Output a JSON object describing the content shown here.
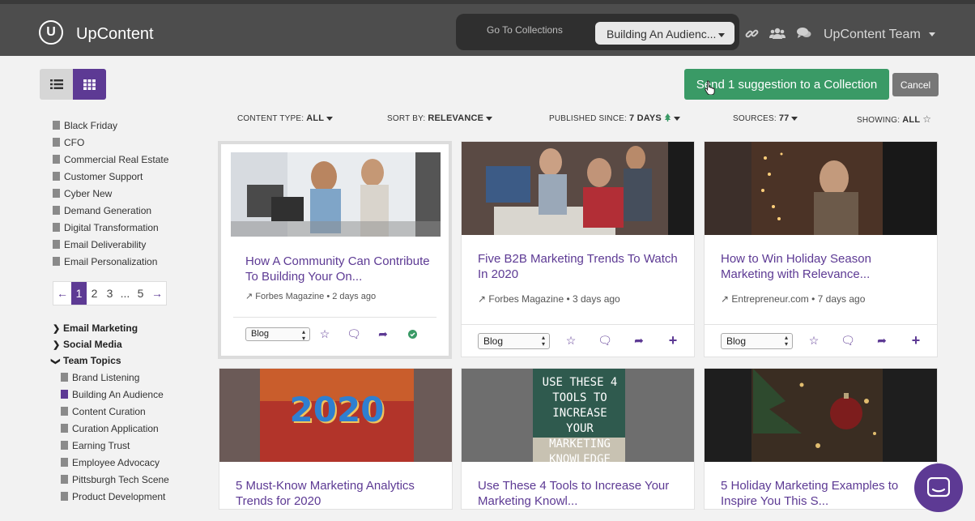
{
  "header": {
    "brand": "UpContent",
    "logo_letter": "U",
    "goto_collections": "Go To Collections",
    "current_collection": "Building An Audienc...",
    "team": "UpContent Team"
  },
  "actions": {
    "send_label": "Send 1 suggestion to a Collection",
    "cancel_label": "Cancel"
  },
  "filters": {
    "content_type_label": "CONTENT TYPE:",
    "content_type_value": "ALL",
    "sort_label": "SORT BY:",
    "sort_value": "RELEVANCE",
    "published_label": "PUBLISHED SINCE:",
    "published_value": "7 DAYS",
    "sources_label": "SOURCES:",
    "sources_value": "77",
    "showing_label": "SHOWING:",
    "showing_value": "ALL"
  },
  "topics": [
    "Black Friday",
    "CFO",
    "Commercial Real Estate",
    "Customer Support",
    "Cyber New",
    "Demand Generation",
    "Digital Transformation",
    "Email Deliverability",
    "Email Personalization"
  ],
  "pagination": [
    "1",
    "2",
    "3",
    "...",
    "5"
  ],
  "groups": {
    "email_marketing": "Email Marketing",
    "social_media": "Social Media",
    "team_topics": "Team Topics"
  },
  "team_topics": [
    "Brand Listening",
    "Building An Audience",
    "Content Curation",
    "Curation Application",
    "Earning Trust",
    "Employee Advocacy",
    "Pittsburgh Tech Scene",
    "Product Development"
  ],
  "cards": [
    {
      "title": "How A Community Can Contribute To Building Your On...",
      "source": "Forbes Magazine",
      "age": "2 days ago",
      "type": "Blog"
    },
    {
      "title": "Five B2B Marketing Trends To Watch In 2020",
      "source": "Forbes Magazine",
      "age": "3 days ago",
      "type": "Blog"
    },
    {
      "title": "How to Win Holiday Season Marketing with Relevance...",
      "source": "Entrepreneur.com",
      "age": "7 days ago",
      "type": "Blog"
    },
    {
      "title": "5 Must-Know Marketing Analytics Trends for 2020",
      "thumb_text": "2020"
    },
    {
      "title": "Use These 4 Tools to Increase Your Marketing Knowl...",
      "thumb_text": "USE THESE 4 TOOLS TO INCREASE YOUR MARKETING KNOWLEDGE"
    },
    {
      "title": "5 Holiday Marketing Examples to Inspire You This S..."
    }
  ],
  "colors": {
    "accent": "#5d3a94",
    "send": "#3a9a66",
    "topbar": "#4d4d4d"
  }
}
